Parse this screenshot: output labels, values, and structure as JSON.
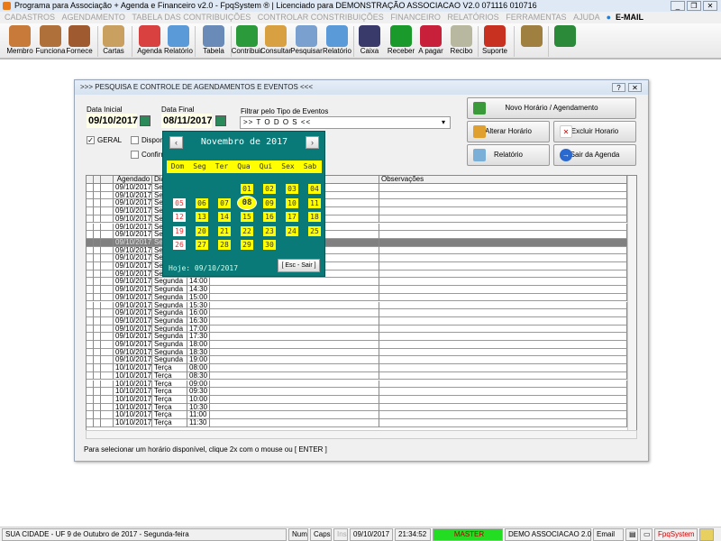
{
  "app": {
    "title": "Programa para Associação + Agenda e Financeiro v2.0 - FpqSystem ® | Licenciado para  DEMONSTRAÇÃO ASSOCIACAO V2.0 071116 010716"
  },
  "menu": [
    "CADASTROS",
    "AGENDAMENTO",
    "TABELA DAS CONTRIBUIÇÕES",
    "CONTROLAR CONSTRIBUIÇÕES",
    "FINANCEIRO",
    "RELATÓRIOS",
    "FERRAMENTAS",
    "AJUDA"
  ],
  "menu_email": "E-MAIL",
  "toolbar": [
    {
      "label": "Membro",
      "icon": "members-icon",
      "color": "#c77a3a"
    },
    {
      "label": "Funciona",
      "icon": "employee-icon",
      "color": "#b0703a"
    },
    {
      "label": "Fornece",
      "icon": "supplier-icon",
      "color": "#a05a30"
    },
    {
      "label": "Cartas",
      "icon": "scroll-icon",
      "color": "#c9a060"
    },
    {
      "label": "Agenda",
      "icon": "calendar-icon",
      "color": "#d94040"
    },
    {
      "label": "Relatório",
      "icon": "report-icon",
      "color": "#5a9ad8"
    },
    {
      "label": "Tabela",
      "icon": "table-icon",
      "color": "#6a8ab8"
    },
    {
      "label": "Contribuir",
      "icon": "dollar-icon",
      "color": "#2a9a3a"
    },
    {
      "label": "Consultar",
      "icon": "folder-icon",
      "color": "#d8a040"
    },
    {
      "label": "Pesquisar",
      "icon": "search-icon",
      "color": "#7aa0d0"
    },
    {
      "label": "Relatório",
      "icon": "report-icon",
      "color": "#5a9ad8"
    },
    {
      "label": "Caixa",
      "icon": "book-icon",
      "color": "#3a3a6a"
    },
    {
      "label": "Receber",
      "icon": "receive-icon",
      "color": "#1a9a2a"
    },
    {
      "label": "A pagar",
      "icon": "pay-icon",
      "color": "#c8203a"
    },
    {
      "label": "Recibo",
      "icon": "receipt-icon",
      "color": "#b8b8a0"
    },
    {
      "label": "Suporte",
      "icon": "support-icon",
      "color": "#c83020"
    },
    {
      "label": "",
      "icon": "coins-icon",
      "color": "#a08040"
    },
    {
      "label": "",
      "icon": "exit-icon",
      "color": "#2a8a3a"
    }
  ],
  "dialog": {
    "title": ">>>  PESQUISA E CONTROLE DE AGENDAMENTOS E EVENTOS  <<<",
    "data_inicial_label": "Data Inicial",
    "data_inicial": "09/10/2017",
    "data_final_label": "Data Final",
    "data_final": "08/11/2017",
    "filter_label": "Filtrar pelo Tipo de Eventos",
    "filter_value": ">> T O D O S <<",
    "chk_geral": "GERAL",
    "chk_disponivel": "Disponi",
    "chk_confirmado": "Confirma",
    "buttons": {
      "novo": "Novo Horário / Agendamento",
      "alterar": "Alterar Horário",
      "excluir": "Excluir Horario",
      "relatorio": "Relatório",
      "sair": "Sair da Agenda"
    },
    "columns": [
      "Agendado",
      "Dia",
      "Observações"
    ],
    "hint": "Para selecionar um horário disponível, clique 2x com o mouse ou [ ENTER ]",
    "rows": [
      [
        "09/10/2017",
        "Segunda",
        ""
      ],
      [
        "09/10/2017",
        "Segunda",
        ""
      ],
      [
        "09/10/2017",
        "Segunda",
        ""
      ],
      [
        "09/10/2017",
        "Segunda",
        ""
      ],
      [
        "09/10/2017",
        "Segunda",
        ""
      ],
      [
        "09/10/2017",
        "Segunda",
        ""
      ],
      [
        "09/10/2017",
        "Segunda",
        ""
      ],
      [
        "09/10/2017",
        "Segunda",
        ""
      ],
      [
        "09/10/2017",
        "Segunda",
        ""
      ],
      [
        "09/10/2017",
        "Segunda",
        ""
      ],
      [
        "09/10/2017",
        "Segunda",
        ""
      ],
      [
        "09/10/2017",
        "Segunda",
        ""
      ],
      [
        "09/10/2017",
        "Segunda",
        "14:00"
      ],
      [
        "09/10/2017",
        "Segunda",
        "14:30"
      ],
      [
        "09/10/2017",
        "Segunda",
        "15:00"
      ],
      [
        "09/10/2017",
        "Segunda",
        "15:30"
      ],
      [
        "09/10/2017",
        "Segunda",
        "16:00"
      ],
      [
        "09/10/2017",
        "Segunda",
        "16:30"
      ],
      [
        "09/10/2017",
        "Segunda",
        "17:00"
      ],
      [
        "09/10/2017",
        "Segunda",
        "17:30"
      ],
      [
        "09/10/2017",
        "Segunda",
        "18:00"
      ],
      [
        "09/10/2017",
        "Segunda",
        "18:30"
      ],
      [
        "09/10/2017",
        "Segunda",
        "19:00"
      ],
      [
        "10/10/2017",
        "Terça",
        "08:00"
      ],
      [
        "10/10/2017",
        "Terça",
        "08:30"
      ],
      [
        "10/10/2017",
        "Terça",
        "09:00"
      ],
      [
        "10/10/2017",
        "Terça",
        "09:30"
      ],
      [
        "10/10/2017",
        "Terça",
        "10:00"
      ],
      [
        "10/10/2017",
        "Terça",
        "10:30"
      ],
      [
        "10/10/2017",
        "Terça",
        "11:00"
      ],
      [
        "10/10/2017",
        "Terça",
        "11:30"
      ]
    ],
    "selected_row": 7
  },
  "calendar": {
    "month": "Novembro de 2017",
    "weekdays": [
      "Dom",
      "Seg",
      "Ter",
      "Qua",
      "Qui",
      "Sex",
      "Sab"
    ],
    "first_weekday": 3,
    "days": 30,
    "selected": "08",
    "hoje": "Hoje: 09/10/2017",
    "esc": "[ Esc - Sair ]"
  },
  "status": {
    "city": "SUA CIDADE - UF  9 de Outubro de 2017 - Segunda-feira",
    "num": "Num",
    "caps": "Caps",
    "ins": "Ins",
    "date": "09/10/2017",
    "time": "21:34:52",
    "user": "MASTER",
    "user_color": "#22dd22",
    "company": "DEMO ASSOCIACAO 2.0",
    "email": "Email",
    "brand": "FpqSystem"
  }
}
